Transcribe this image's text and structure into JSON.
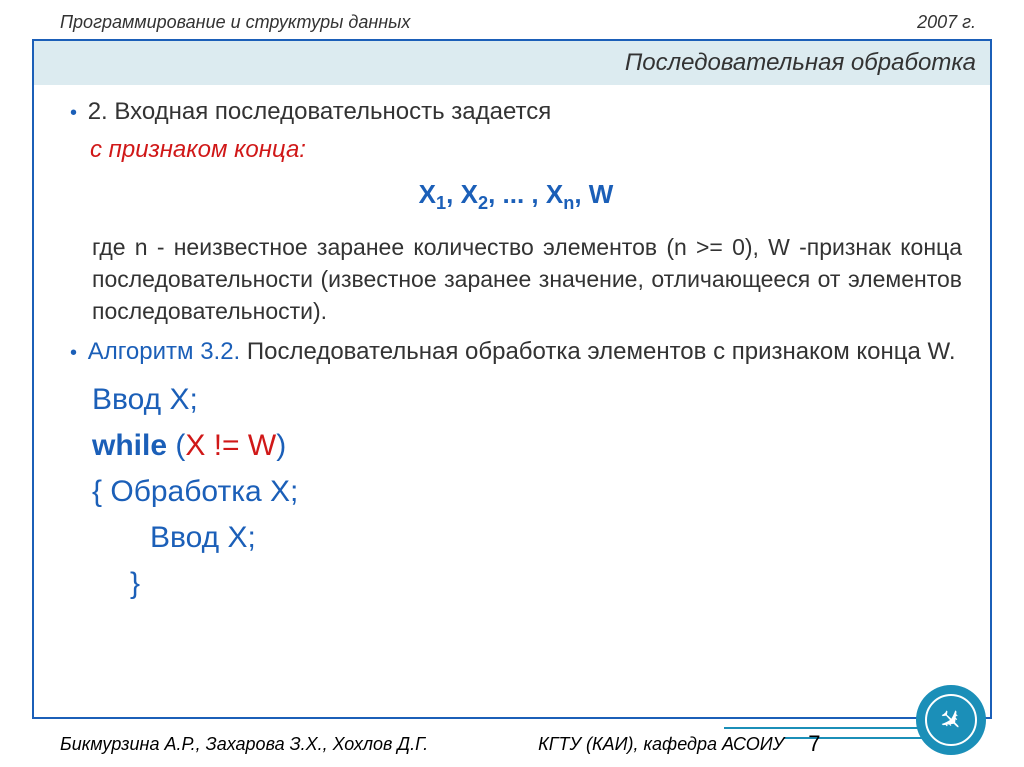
{
  "header": {
    "left": "Программирование и структуры данных",
    "right": "2007 г."
  },
  "slide": {
    "title": "Последовательная обработка",
    "point_num": "2. ",
    "point_text": "Входная последовательность задается",
    "end_marker_label": "с признаком конца:",
    "sequence_x": "X",
    "sequence_1": "1",
    "sequence_2": "2",
    "sequence_dots": ", ... , ",
    "sequence_n": "n",
    "sequence_w": ", W",
    "explain": "где n - неизвестное заранее количество элементов (n >= 0), W -признак конца последовательности (известное заранее значение, отличающееся от элементов последовательности).",
    "algo_label": "Алгоритм 3.2. ",
    "algo_text": "Последовательная обработка элементов с признаком конца W.",
    "code": {
      "line1": "Ввод X;",
      "while_kw": "while",
      "while_open": " (",
      "while_cond": "X != W",
      "while_close": ")",
      "brace_open": "{  ",
      "process": "Обработка X;",
      "input2": "Ввод X;",
      "brace_close": "}"
    }
  },
  "footer": {
    "authors": "Бикмурзина А.Р., Захарова З.Х., Хохлов Д.Г.",
    "affiliation": "КГТУ (КАИ), кафедра АСОИУ",
    "page": "7"
  }
}
